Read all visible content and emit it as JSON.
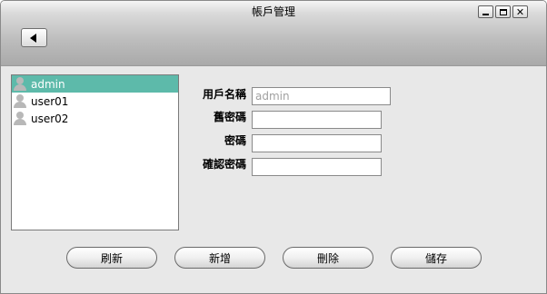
{
  "window": {
    "title": "帳戶管理",
    "minimize_icon": "minimize-icon",
    "maximize_icon": "maximize-icon",
    "close_icon": "close-icon",
    "close_glyph": "✕"
  },
  "toolbar": {
    "back_icon": "back-arrow-icon"
  },
  "users": {
    "items": [
      {
        "label": "admin",
        "selected": true
      },
      {
        "label": "user01",
        "selected": false
      },
      {
        "label": "user02",
        "selected": false
      }
    ],
    "selected_color": "#5dbaaa"
  },
  "form": {
    "username_label": "用戶名稱",
    "username_value": "admin",
    "old_password_label": "舊密碼",
    "password_label": "密碼",
    "confirm_password_label": "確認密碼"
  },
  "actions": {
    "refresh": "刷新",
    "add": "新增",
    "delete": "刪除",
    "save": "儲存"
  }
}
